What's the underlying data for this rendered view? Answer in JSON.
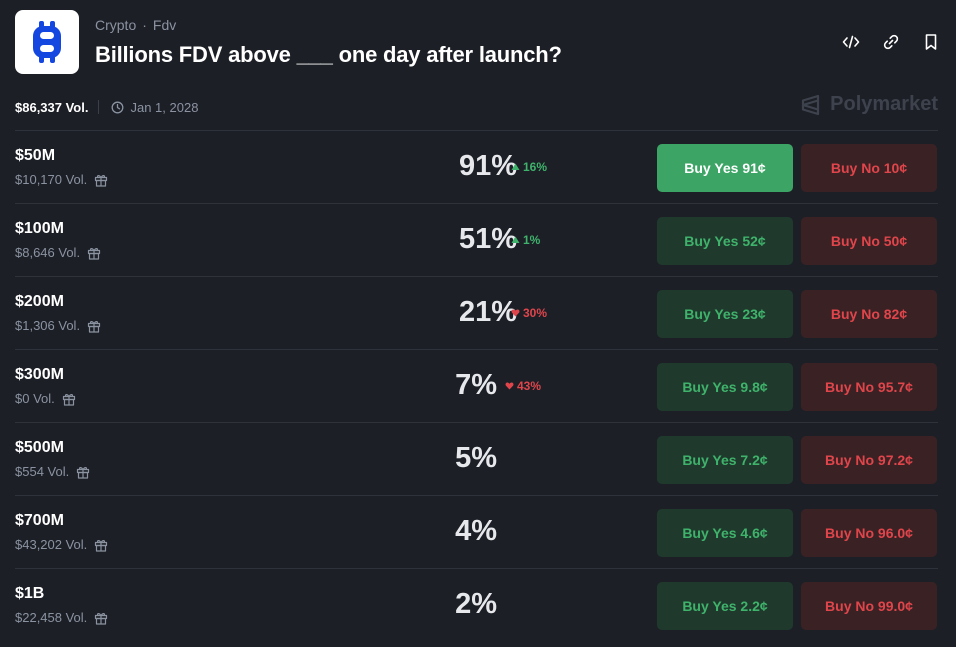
{
  "header": {
    "breadcrumb": [
      "Crypto",
      "Fdv"
    ],
    "separator": "·",
    "title": "Billions FDV above ___ one day after launch?",
    "actions": [
      "embed-icon",
      "link-icon",
      "bookmark-icon"
    ]
  },
  "meta": {
    "volume": "$86,337 Vol.",
    "date": "Jan 1, 2028",
    "brand": "Polymarket"
  },
  "colors": {
    "background": "#1c1f26",
    "yes": "#3fb36b",
    "no": "#e0454b",
    "yes_active_bg": "#3ca565"
  },
  "outcomes": [
    {
      "label": "$50M",
      "volume": "$10,170 Vol.",
      "percent": "91%",
      "change": "16%",
      "direction": "up",
      "yes": "Buy Yes 91¢",
      "no": "Buy No 10¢",
      "yes_active": true
    },
    {
      "label": "$100M",
      "volume": "$8,646 Vol.",
      "percent": "51%",
      "change": "1%",
      "direction": "up",
      "yes": "Buy Yes 52¢",
      "no": "Buy No 50¢",
      "yes_active": false
    },
    {
      "label": "$200M",
      "volume": "$1,306 Vol.",
      "percent": "21%",
      "change": "30%",
      "direction": "down",
      "yes": "Buy Yes 23¢",
      "no": "Buy No 82¢",
      "yes_active": false
    },
    {
      "label": "$300M",
      "volume": "$0 Vol.",
      "percent": "7%",
      "change": "43%",
      "direction": "down",
      "yes": "Buy Yes 9.8¢",
      "no": "Buy No 95.7¢",
      "yes_active": false
    },
    {
      "label": "$500M",
      "volume": "$554 Vol.",
      "percent": "5%",
      "change": "",
      "direction": "",
      "yes": "Buy Yes 7.2¢",
      "no": "Buy No 97.2¢",
      "yes_active": false
    },
    {
      "label": "$700M",
      "volume": "$43,202 Vol.",
      "percent": "4%",
      "change": "",
      "direction": "",
      "yes": "Buy Yes 4.6¢",
      "no": "Buy No 96.0¢",
      "yes_active": false
    },
    {
      "label": "$1B",
      "volume": "$22,458 Vol.",
      "percent": "2%",
      "change": "",
      "direction": "",
      "yes": "Buy Yes 2.2¢",
      "no": "Buy No 99.0¢",
      "yes_active": false
    }
  ]
}
